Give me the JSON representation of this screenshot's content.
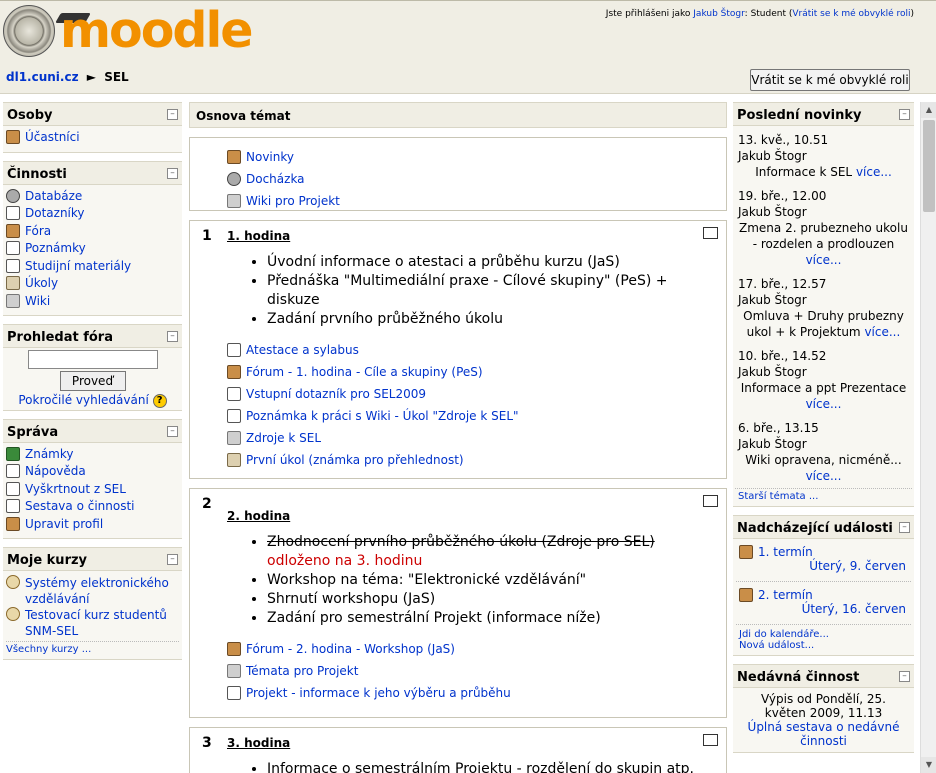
{
  "header": {
    "logo_text": "moodle",
    "login_prefix": "Jste přihlášeni jako",
    "user_name": "Jakub Štogr",
    "role_text": ": Student (",
    "return_link": "Vrátit se k mé obvyklé roli",
    "role_close": ")"
  },
  "navbar": {
    "site": "dl1.cuni.cz",
    "separator": "►",
    "course": "SEL",
    "return_button": "Vrátit se k mé obvyklé roli"
  },
  "left": {
    "people": {
      "title": "Osoby",
      "items": [
        {
          "label": "Účastníci",
          "icon": "participants-icon"
        }
      ]
    },
    "activities": {
      "title": "Činnosti",
      "items": [
        {
          "label": "Databáze",
          "icon": "database-icon"
        },
        {
          "label": "Dotazníky",
          "icon": "questionnaire-icon"
        },
        {
          "label": "Fóra",
          "icon": "forum-icon"
        },
        {
          "label": "Poznámky",
          "icon": "notes-icon"
        },
        {
          "label": "Studijní materiály",
          "icon": "resource-icon"
        },
        {
          "label": "Úkoly",
          "icon": "assignment-icon"
        },
        {
          "label": "Wiki",
          "icon": "wiki-icon"
        }
      ]
    },
    "search": {
      "title": "Prohledat fóra",
      "placeholder": "",
      "button": "Proveď",
      "advanced": "Pokročilé vyhledávání",
      "help": "?"
    },
    "admin": {
      "title": "Správa",
      "items": [
        {
          "label": "Známky",
          "icon": "grades-icon"
        },
        {
          "label": "Nápověda",
          "icon": "help-page-icon"
        },
        {
          "label": "Vyškrtnout z SEL",
          "icon": "unenrol-icon"
        },
        {
          "label": "Sestava o činnosti",
          "icon": "report-icon"
        },
        {
          "label": "Upravit profil",
          "icon": "profile-icon"
        }
      ]
    },
    "courses": {
      "title": "Moje kurzy",
      "items": [
        {
          "label": "Systémy elektronického vzdělávání",
          "icon": "course-icon"
        },
        {
          "label": "Testovací kurz studentů SNM-SEL",
          "icon": "course-icon"
        }
      ],
      "all": "Všechny kurzy ..."
    }
  },
  "main": {
    "heading": "Osnova témat",
    "section0": [
      {
        "label": "Novinky",
        "icon": "forum-icon"
      },
      {
        "label": "Docházka",
        "icon": "attendance-icon"
      },
      {
        "label": "Wiki pro Projekt",
        "icon": "wiki-icon"
      }
    ],
    "sections": [
      {
        "num": "1",
        "title": "1. hodina",
        "bullets": [
          "Úvodní informace o atestaci a průběhu kurzu (JaS)",
          "Přednáška \"Multimediální praxe - Cílové skupiny\" (PeS) + diskuze",
          "Zadání prvního průběžného úkolu"
        ],
        "activities": [
          {
            "label": "Atestace a sylabus",
            "icon": "page-icon"
          },
          {
            "label": "Fórum - 1. hodina - Cíle a skupiny (PeS)",
            "icon": "forum-icon"
          },
          {
            "label": "Vstupní dotazník pro SEL2009",
            "icon": "questionnaire-icon"
          },
          {
            "label": "Poznámka k práci s Wiki - Úkol \"Zdroje k SEL\"",
            "icon": "note-icon"
          },
          {
            "label": "Zdroje k SEL",
            "icon": "wiki-icon"
          },
          {
            "label": "První úkol (známka pro přehlednost)",
            "icon": "assignment-icon"
          }
        ]
      },
      {
        "num": "2",
        "title": "2. hodina",
        "struck": "Zhodnocení prvního průběžného úkolu (Zdroje pro SEL)",
        "postponed": "odloženo na 3. hodinu",
        "bullets": [
          "Workshop na téma: \"Elektronické vzdělávání\"",
          "Shrnutí workshopu (JaS)",
          "Zadání pro semestrální Projekt (informace níže)"
        ],
        "activities": [
          {
            "label": "Fórum - 2. hodina - Workshop (JaS)",
            "icon": "forum-icon"
          },
          {
            "label": "Témata pro Projekt",
            "icon": "wiki-icon"
          },
          {
            "label": "Projekt - informace k jeho výběru a průběhu",
            "icon": "page-icon"
          }
        ]
      },
      {
        "num": "3",
        "title": "3. hodina",
        "bullets": [
          "Informace o semestrálním Projektu - rozdělení do skupin atp."
        ]
      }
    ]
  },
  "right": {
    "news": {
      "title": "Poslední novinky",
      "items": [
        {
          "date": "13. kvě., 10.51",
          "author": "Jakub Štogr",
          "text": "Informace k SEL",
          "more": "více..."
        },
        {
          "date": "19. bře., 12.00",
          "author": "Jakub Štogr",
          "text": "Zmena 2. prubezneho ukolu - rozdelen a prodlouzen",
          "more": "více..."
        },
        {
          "date": "17. bře., 12.57",
          "author": "Jakub Štogr",
          "text": "Omluva + Druhy prubezny ukol + k Projektum",
          "more": "více..."
        },
        {
          "date": "10. bře., 14.52",
          "author": "Jakub Štogr",
          "text": "Informace a ppt Prezentace",
          "more": "více..."
        },
        {
          "date": "6. bře., 13.15",
          "author": "Jakub Štogr",
          "text": "Wiki opravena, nicméně...",
          "more": "více..."
        }
      ],
      "older": "Starší témata ..."
    },
    "events": {
      "title": "Nadcházející události",
      "items": [
        {
          "label": "1. termín",
          "when": "Úterý, 9. červen"
        },
        {
          "label": "2. termín",
          "when": "Úterý, 16. červen"
        }
      ],
      "calendar": "Jdi do kalendáře...",
      "new_event": "Nová událost..."
    },
    "recent": {
      "title": "Nedávná činnost",
      "since": "Výpis od Pondělí, 25. květen 2009, 11.13",
      "full_report": "Úplná sestava o nedávné činnosti"
    }
  }
}
